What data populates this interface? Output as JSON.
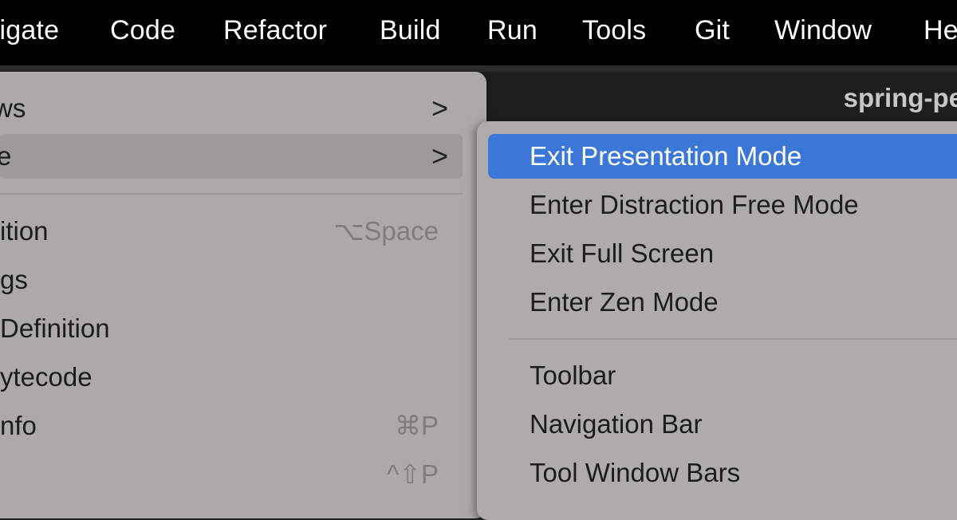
{
  "menubar": {
    "items": [
      "rigate",
      "Code",
      "Refactor",
      "Build",
      "Run",
      "Tools",
      "Git",
      "Window",
      "He"
    ]
  },
  "window": {
    "title": "spring-pe"
  },
  "menu_left": {
    "items": [
      {
        "label": "ws",
        "has_submenu": true
      },
      {
        "label": "e",
        "has_submenu": true
      },
      {
        "label": "ition",
        "shortcut": "⌥Space"
      },
      {
        "label": "gs"
      },
      {
        "label": " Definition"
      },
      {
        "label": "ytecode"
      },
      {
        "label": "nfo",
        "shortcut": "⌘P"
      },
      {
        "label": "",
        "shortcut": "^⇧P"
      }
    ],
    "chevron": ">"
  },
  "submenu": {
    "items": [
      {
        "label": "Exit Presentation Mode",
        "active": true
      },
      {
        "label": "Enter Distraction Free Mode"
      },
      {
        "label": "Exit Full Screen"
      },
      {
        "label": "Enter Zen Mode"
      },
      {
        "label": "Toolbar"
      },
      {
        "label": "Navigation Bar"
      },
      {
        "label": "Tool Window Bars"
      }
    ]
  },
  "colors": {
    "menubar_bg": "#000000",
    "menu_bg": "#aca9ab",
    "highlight_blue": "#3b77d8"
  }
}
